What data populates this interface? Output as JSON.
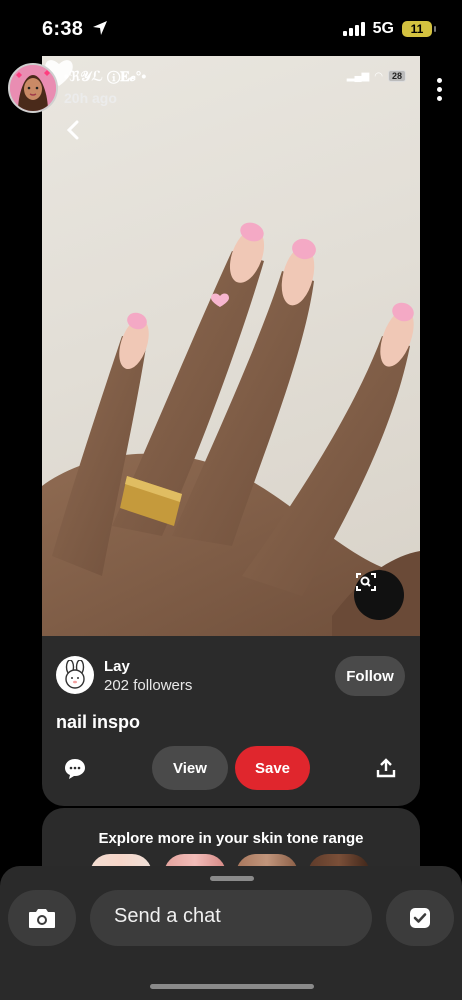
{
  "status_bar": {
    "time": "6:38",
    "network": "5G",
    "battery": "11"
  },
  "story": {
    "user_name": "•ℜ𝒴ℒ ⓘ𝐄𝓮°•",
    "time_ago": "20h ago",
    "inner_battery": "28"
  },
  "pin": {
    "creator_name": "Lay",
    "followers": "202 followers",
    "follow_label": "Follow",
    "title": "nail inspo",
    "view_label": "View",
    "save_label": "Save"
  },
  "explore": {
    "title": "Explore more in your skin tone range"
  },
  "chat": {
    "placeholder": "Send a chat"
  },
  "colors": {
    "save_red": "#e0262d",
    "battery_yellow": "#d4c240",
    "sheet": "#2a2a2a"
  }
}
